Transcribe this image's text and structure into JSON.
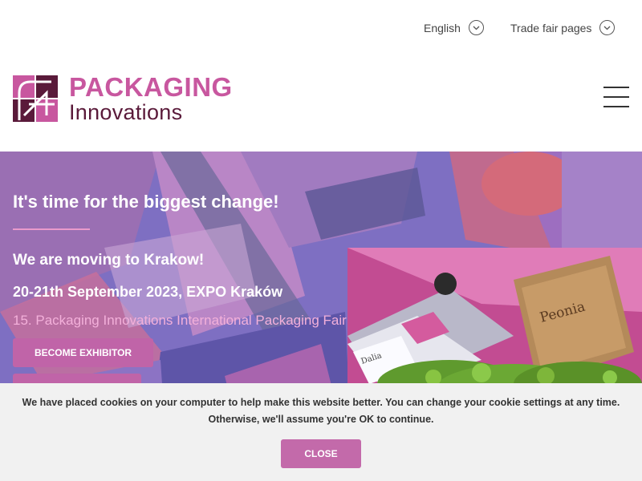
{
  "topbar": {
    "language_label": "English",
    "trade_fair_label": "Trade fair pages"
  },
  "header": {
    "logo_top": "PACKAGING",
    "logo_bottom": "Innovations"
  },
  "hero": {
    "title": "It's time for the biggest change!",
    "subtitle": "We are moving to Krakow!",
    "date": "20-21th September 2023, EXPO Kraków",
    "edition": "15. Packaging Innovations International Packaging Fair",
    "button_exhibitor": "BECOME EXHIBITOR",
    "button_second": "",
    "product_label_peonia": "Peonia",
    "product_label_dalia": "Dalia"
  },
  "cookie": {
    "text": "We have placed cookies on your computer to help make this website better. You can change your cookie settings at any time. Otherwise, we'll assume you're OK to continue.",
    "close_label": "CLOSE"
  },
  "colors": {
    "brand_pink": "#c8579f",
    "brand_dark": "#5a1a3a",
    "button": "#c064a8",
    "cookie_bg": "#f1f1f1"
  }
}
